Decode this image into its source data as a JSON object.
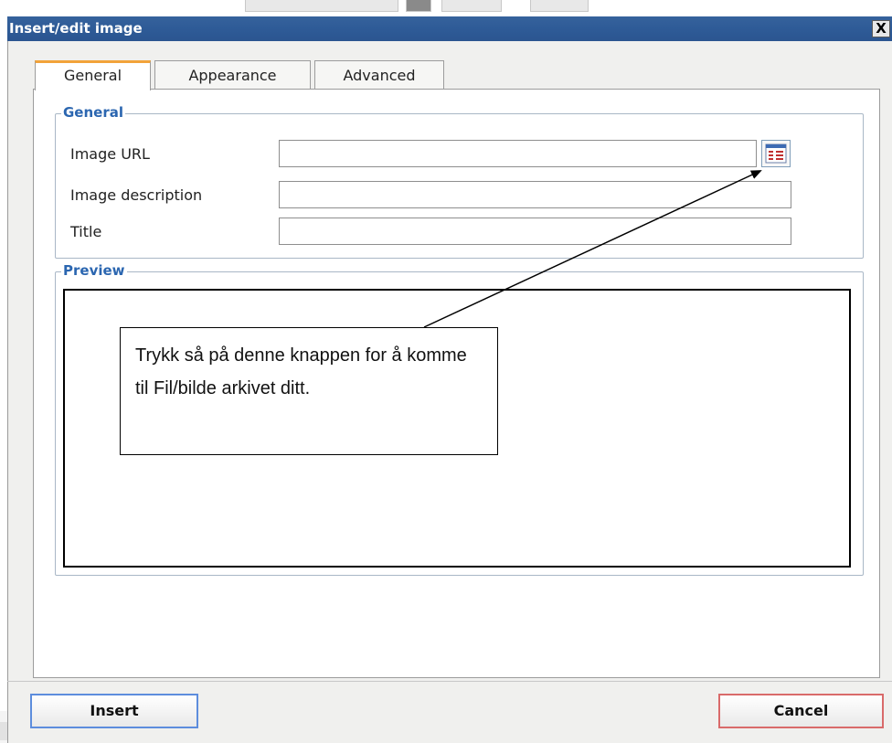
{
  "dialog": {
    "title": "Insert/edit image",
    "close_label": "X"
  },
  "tabs": [
    {
      "label": "General",
      "active": true
    },
    {
      "label": "Appearance",
      "active": false
    },
    {
      "label": "Advanced",
      "active": false
    }
  ],
  "general_section": {
    "legend": "General",
    "fields": [
      {
        "label": "Image URL",
        "value": ""
      },
      {
        "label": "Image description",
        "value": ""
      },
      {
        "label": "Title",
        "value": ""
      }
    ],
    "browse_icon": "file-browser-icon"
  },
  "preview_section": {
    "legend": "Preview"
  },
  "annotation": {
    "text": "Trykk så på denne knappen for å komme til Fil/bilde arkivet ditt."
  },
  "buttons": {
    "insert": "Insert",
    "cancel": "Cancel"
  },
  "colors": {
    "titlebar": "#2e5b97",
    "legend": "#2b66b0",
    "active_tab_accent": "#f2a33a",
    "insert_border": "#5d8ddd",
    "cancel_border": "#d96a6a"
  }
}
